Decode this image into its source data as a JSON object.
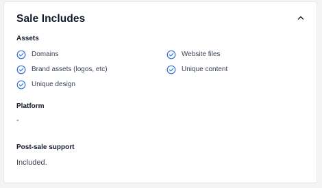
{
  "card": {
    "title": "Sale Includes",
    "collapse_icon": "chevron-up-icon"
  },
  "assets": {
    "label": "Assets",
    "items": [
      {
        "label": "Domains",
        "icon": "check-circle-icon"
      },
      {
        "label": "Website files",
        "icon": "check-circle-icon"
      },
      {
        "label": "Brand assets (logos, etc)",
        "icon": "check-circle-icon"
      },
      {
        "label": "Unique content",
        "icon": "check-circle-icon"
      },
      {
        "label": "Unique design",
        "icon": "check-circle-icon"
      }
    ]
  },
  "platform": {
    "label": "Platform",
    "value": "-"
  },
  "post_sale_support": {
    "label": "Post-sale support",
    "value": "Included."
  },
  "colors": {
    "check_accent": "#2f6fd6",
    "text_primary": "#111827",
    "text_secondary": "#374151",
    "border": "#e5e7eb"
  }
}
